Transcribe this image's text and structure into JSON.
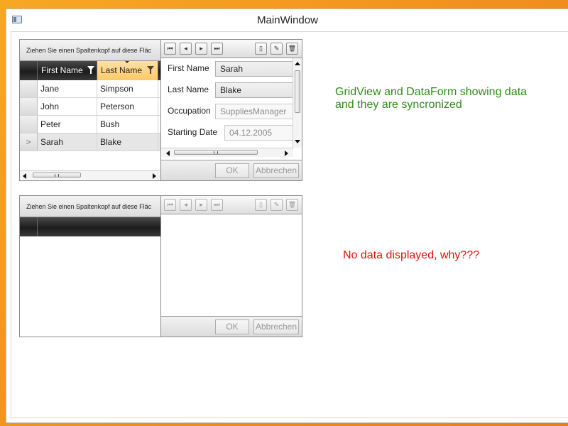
{
  "window": {
    "title": "MainWindow"
  },
  "colors": {
    "note_green": "#2e8b1a",
    "note_red": "#e01010",
    "sorted_header": "#ffc966"
  },
  "grid1": {
    "group_panel_text": "Ziehen Sie einen Spaltenkopf auf diese Fläc",
    "columns": [
      "First Name",
      "Last Name"
    ],
    "rows": [
      {
        "first": "Jane",
        "last": "Simpson",
        "indicator": ""
      },
      {
        "first": "John",
        "last": "Peterson",
        "indicator": ""
      },
      {
        "first": "Peter",
        "last": "Bush",
        "indicator": ""
      },
      {
        "first": "Sarah",
        "last": "Blake",
        "indicator": ">"
      }
    ]
  },
  "dataform1": {
    "toolbar_icons": [
      "first-icon",
      "previous-icon",
      "next-icon",
      "last-icon",
      "new-icon",
      "edit-icon",
      "delete-icon"
    ],
    "fields": [
      {
        "label": "First Name",
        "value": "Sarah"
      },
      {
        "label": "Last Name",
        "value": "Blake"
      },
      {
        "label": "Occupation",
        "value": "SuppliesManager"
      },
      {
        "label": "Starting Date",
        "value": "04.12.2005"
      }
    ],
    "ok_label": "OK",
    "cancel_label": "Abbrechen"
  },
  "grid2": {
    "group_panel_text": "Ziehen Sie einen Spaltenkopf auf diese Fläc"
  },
  "dataform2": {
    "ok_label": "OK",
    "cancel_label": "Abbrechen"
  },
  "notes": {
    "top_line1": "GridView and DataForm showing data",
    "top_line2": "and they are syncronized",
    "bottom": "No data displayed, why???"
  }
}
